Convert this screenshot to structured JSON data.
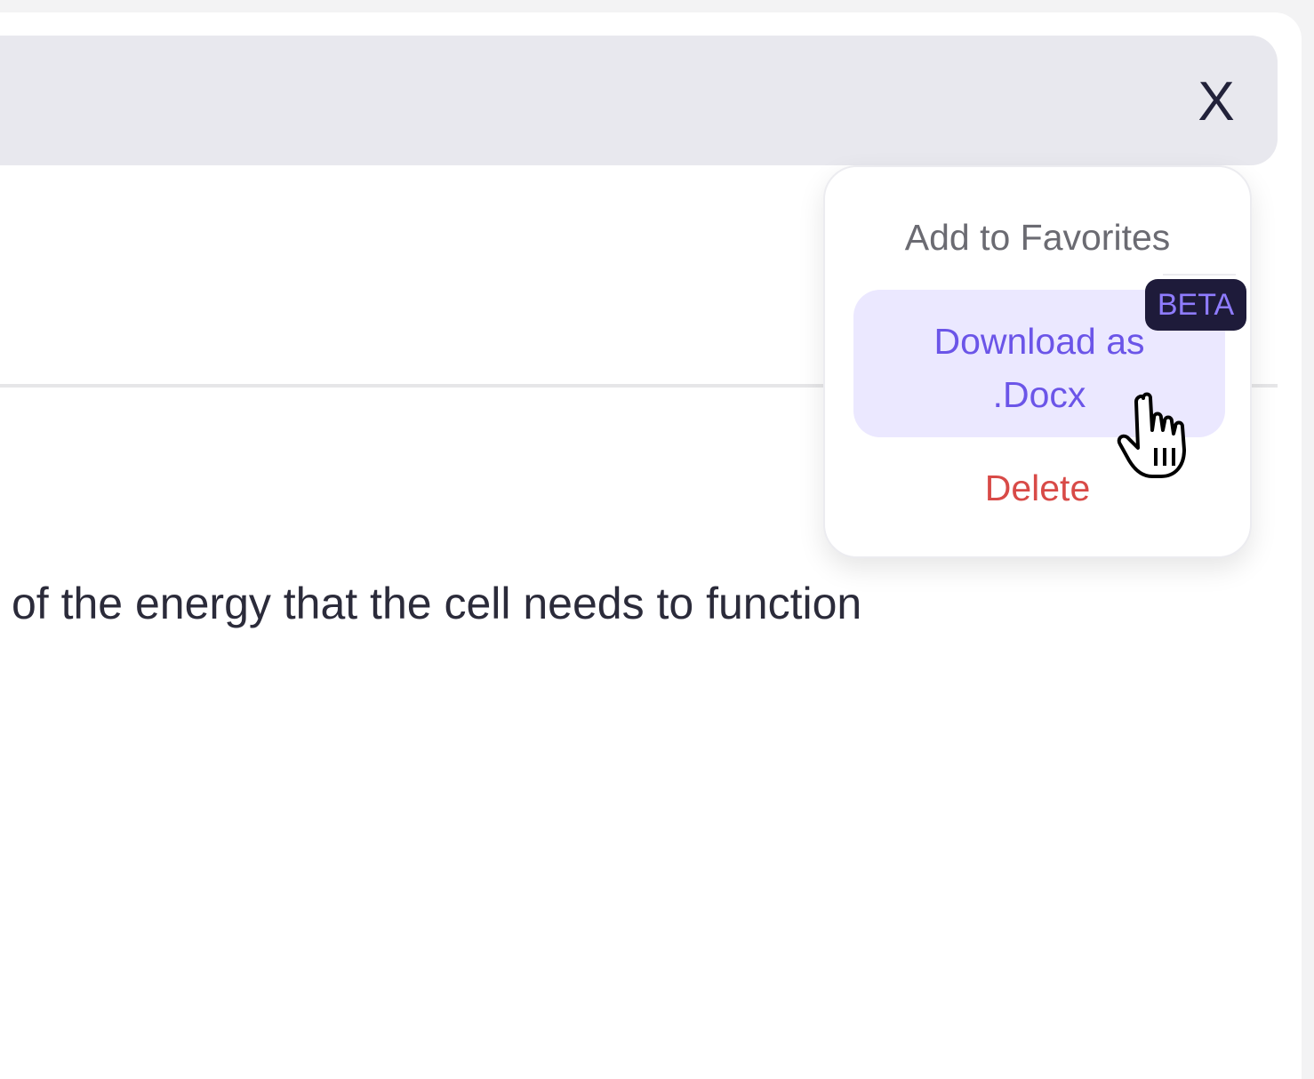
{
  "header": {
    "close_label": "X"
  },
  "content": {
    "text": "of the energy that the cell needs to function"
  },
  "menu": {
    "favorites_label": "Add to Favorites",
    "download_line1": "Download as",
    "download_line2": ".Docx",
    "beta_badge": "BETA",
    "delete_label": "Delete"
  },
  "colors": {
    "header_bg": "#e8e8ee",
    "download_bg": "#ebe8ff",
    "download_text": "#6b55e8",
    "beta_bg": "#1e1b3a",
    "beta_text": "#8f7cff",
    "delete_text": "#d84a47"
  },
  "icons": {
    "cursor": "hand-pointer-icon"
  }
}
